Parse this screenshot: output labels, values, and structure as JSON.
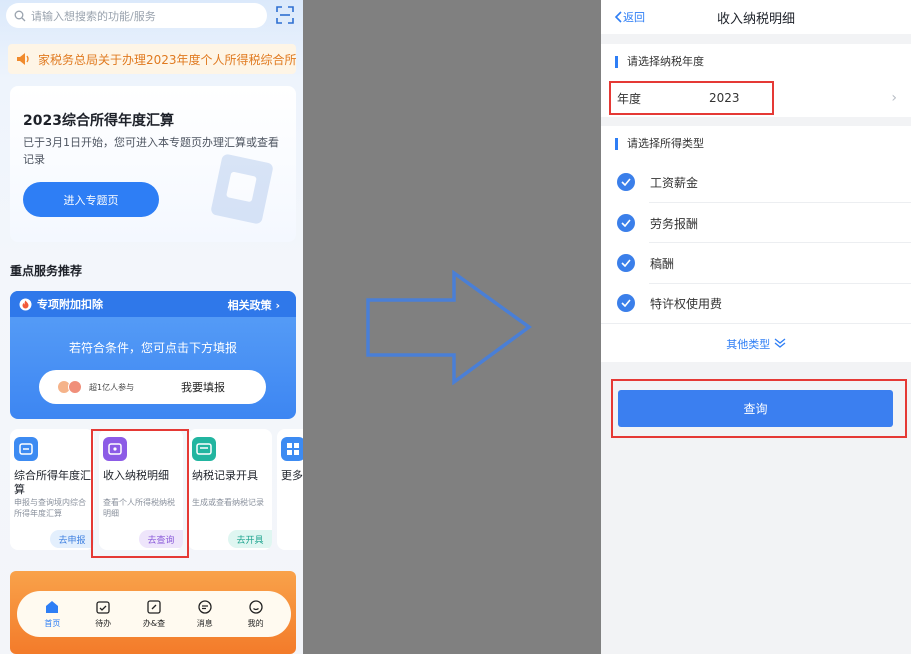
{
  "left": {
    "search": {
      "placeholder": "请输入想搜索的功能/服务"
    },
    "notice": {
      "text": "家税务总局关于办理2023年度个人所得税综合所"
    },
    "annual": {
      "title": "2023综合所得年度汇算",
      "desc": "已于3月1日开始，您可进入本专题页办理汇算或查看记录",
      "button": "进入专题页"
    },
    "section_title": "重点服务推荐",
    "special": {
      "title": "专项附加扣除",
      "policy": "相关政策 ›",
      "hint": "若符合条件，您可点击下方填报",
      "participants": "超1亿人参与",
      "fill": "我要填报"
    },
    "cards": [
      {
        "title": "综合所得年度汇算",
        "desc": "申报与查询境内综合所得年度汇算",
        "tag": "去申报"
      },
      {
        "title": "收入纳税明细",
        "desc": "查看个人所得税纳税明细",
        "tag": "去查询"
      },
      {
        "title": "纳税记录开具",
        "desc": "生成或查看纳税记录",
        "tag": "去开具"
      },
      {
        "title": "更多"
      }
    ],
    "tabs": [
      {
        "label": "首页",
        "icon": "home-icon"
      },
      {
        "label": "待办",
        "icon": "calendar-icon"
      },
      {
        "label": "办&查",
        "icon": "edit-icon"
      },
      {
        "label": "消息",
        "icon": "message-icon"
      },
      {
        "label": "我的",
        "icon": "user-icon"
      }
    ]
  },
  "right": {
    "back": "返回",
    "title": "收入纳税明细",
    "year_section": "请选择纳税年度",
    "year_label": "年度",
    "year_value": "2023",
    "type_section": "请选择所得类型",
    "types": [
      "工资薪金",
      "劳务报酬",
      "稿酬",
      "特许权使用费"
    ],
    "more_types": "其他类型",
    "query": "查询"
  },
  "colors": {
    "accent": "#2e7ef5",
    "highlight": "#e53935",
    "arrow": "#4a7fd6"
  }
}
